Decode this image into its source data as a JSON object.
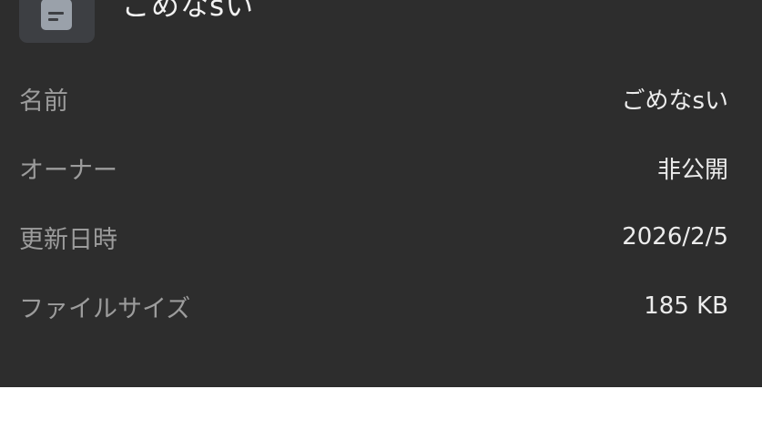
{
  "header": {
    "file_icon": "document-icon",
    "title": "ごめなsい"
  },
  "details": {
    "rows": [
      {
        "label": "名前",
        "value": "ごめなsい"
      },
      {
        "label": "オーナー",
        "value": "非公開"
      },
      {
        "label": "更新日時",
        "value": "2026/2/5"
      },
      {
        "label": "ファイルサイズ",
        "value": "185 KB"
      }
    ]
  },
  "colors": {
    "sheet_background": "#2d2d2d",
    "icon_tile": "#3d3f43",
    "label_text": "#9c9c9c",
    "value_text": "#ececec"
  }
}
